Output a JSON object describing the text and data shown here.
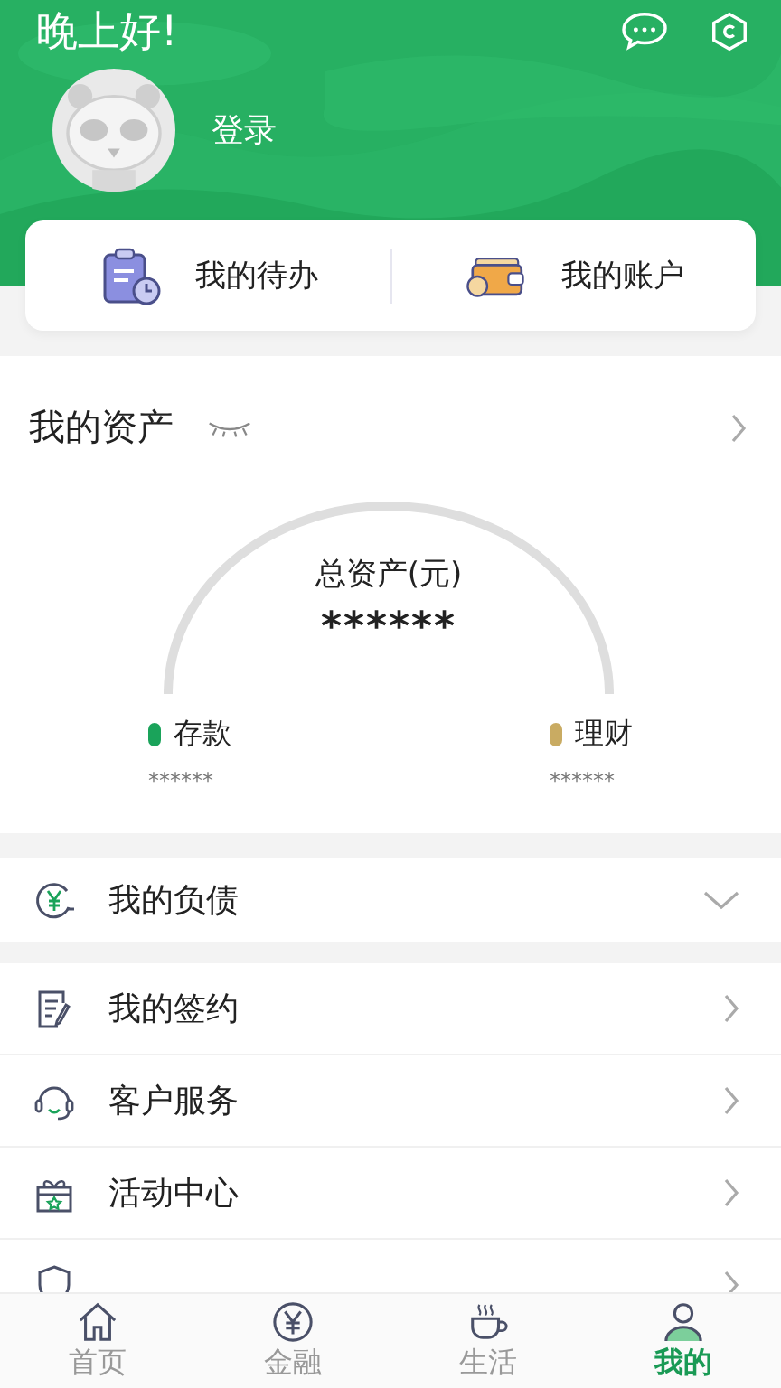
{
  "header": {
    "greeting": "晚上好!",
    "login": "登录"
  },
  "shortcuts": [
    {
      "kind": "todo",
      "label": "我的待办"
    },
    {
      "kind": "account",
      "label": "我的账户"
    }
  ],
  "assets": {
    "title": "我的资产",
    "total_label": "总资产(元)",
    "total_value": "******",
    "items": [
      {
        "label": "存款",
        "value": "******",
        "color": "#1aa35a"
      },
      {
        "label": "理财",
        "value": "******",
        "color": "#c9ab62"
      }
    ]
  },
  "liability": {
    "label": "我的负债",
    "expanded": false
  },
  "menu": [
    {
      "kind": "sign",
      "label": "我的签约"
    },
    {
      "kind": "service",
      "label": "客户服务"
    },
    {
      "kind": "activity",
      "label": "活动中心"
    },
    {
      "kind": "security"
    }
  ],
  "tabs": [
    {
      "kind": "home",
      "label": "首页",
      "selected": false
    },
    {
      "kind": "finance",
      "label": "金融",
      "selected": false
    },
    {
      "kind": "life",
      "label": "生活",
      "selected": false
    },
    {
      "kind": "me",
      "label": "我的",
      "selected": true
    }
  ]
}
